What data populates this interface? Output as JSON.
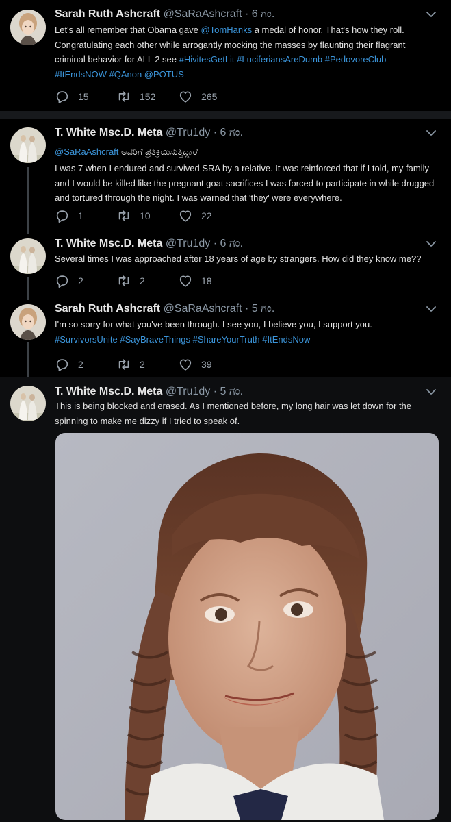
{
  "tweets": [
    {
      "name": "Sarah Ruth Ashcraft",
      "handle": "@SaRaAshcraft",
      "dot": "·",
      "time": "6 ಗಂ.",
      "text_parts": [
        "Let's all remember that Obama gave ",
        "@TomHanks",
        " a medal of honor. That's how they roll. Congratulating each other while arrogantly mocking the masses by flaunting their flagrant criminal behavior for ALL 2 see ",
        "#HivitesGetLit #LuciferiansAreDumb #PedovoreClub #ItEndsNOW #QAnon @POTUS"
      ],
      "replies": "15",
      "retweets": "152",
      "likes": "265"
    },
    {
      "name": "T. White Msc.D. Meta",
      "handle": "@Tru1dy",
      "dot": "·",
      "time": "6 ಗಂ.",
      "reply_to": "@SaRaAshcraft",
      "reply_suffix": " ಅವರಿಗೆ ಪ್ರತಿಕ್ರಿಯಿಸುತ್ತಿದ್ದಾರೆ",
      "text": "I was 7 when I endured and survived SRA by a relative. It was reinforced that if I told, my family and I would be killed like the pregnant goat  sacrifices I was forced to participate in while drugged and tortured through the night. I was warned that 'they' were everywhere.",
      "replies": "1",
      "retweets": "10",
      "likes": "22"
    },
    {
      "name": "T. White Msc.D. Meta",
      "handle": "@Tru1dy",
      "dot": "·",
      "time": "6 ಗಂ.",
      "text": "Several times I was approached after 18 years of age by strangers. How did they know me??",
      "replies": "2",
      "retweets": "2",
      "likes": "18"
    },
    {
      "name": "Sarah Ruth Ashcraft",
      "handle": "@SaRaAshcraft",
      "dot": "·",
      "time": "5 ಗಂ.",
      "text_parts": [
        "I'm so sorry for what you've been through. I see you, I believe you, I support you. ",
        "#SurvivorsUnite #SayBraveThings #ShareYourTruth #ItEndsNow"
      ],
      "replies": "2",
      "retweets": "2",
      "likes": "39"
    },
    {
      "name": "T. White Msc.D. Meta",
      "handle": "@Tru1dy",
      "dot": "·",
      "time": "5 ಗಂ.",
      "text": "This is being blocked and erased. As I mentioned before, my long hair was let down for the spinning to make me dizzy if I tried to speak of."
    }
  ],
  "colors": {
    "background": "#000000",
    "link": "#3b94d9",
    "muted": "#8b98a5",
    "divider": "#2a2f33"
  },
  "icons": [
    "reply-icon",
    "retweet-icon",
    "like-icon",
    "chevron-down-icon"
  ]
}
